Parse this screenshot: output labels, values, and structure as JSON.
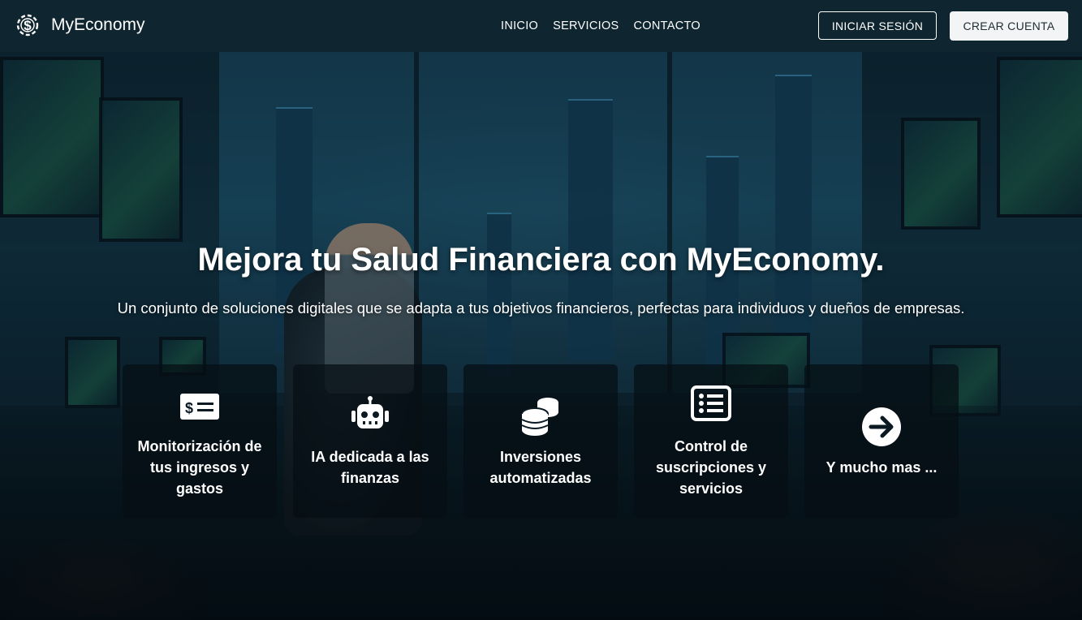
{
  "brand": {
    "name": "MyEconomy",
    "icon": "dollar-gear-icon"
  },
  "nav": {
    "items": [
      "INICIO",
      "SERVICIOS",
      "CONTACTO"
    ],
    "login_label": "INICIAR SESIÓN",
    "signup_label": "CREAR CUENTA"
  },
  "hero": {
    "title": "Mejora tu Salud Financiera con MyEconomy.",
    "subtitle": "Un conjunto de soluciones digitales que se adapta a tus objetivos financieros, perfectas para individuos y dueños de empresas."
  },
  "features": [
    {
      "icon": "money-bill-icon",
      "label": "Monitorización de tus ingresos y gastos"
    },
    {
      "icon": "robot-icon",
      "label": "IA dedicada a las finanzas"
    },
    {
      "icon": "coins-icon",
      "label": "Inversiones automatizadas"
    },
    {
      "icon": "list-icon",
      "label": "Control de suscripciones y servicios"
    },
    {
      "icon": "arrow-right-circle-icon",
      "label": "Y mucho mas ..."
    }
  ],
  "colors": {
    "navbar": "#0f252f",
    "card_bg": "rgba(5,14,19,0.72)",
    "text": "#ffffff",
    "solid_button": "#f2f4f5"
  }
}
